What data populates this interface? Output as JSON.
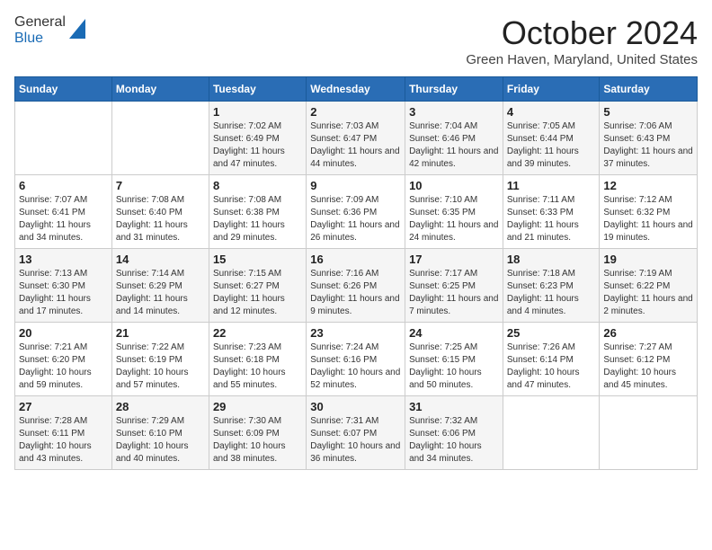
{
  "header": {
    "logo_line1": "General",
    "logo_line2": "Blue",
    "month_title": "October 2024",
    "location": "Green Haven, Maryland, United States"
  },
  "weekdays": [
    "Sunday",
    "Monday",
    "Tuesday",
    "Wednesday",
    "Thursday",
    "Friday",
    "Saturday"
  ],
  "weeks": [
    [
      {
        "day": "",
        "sunrise": "",
        "sunset": "",
        "daylight": ""
      },
      {
        "day": "",
        "sunrise": "",
        "sunset": "",
        "daylight": ""
      },
      {
        "day": "1",
        "sunrise": "Sunrise: 7:02 AM",
        "sunset": "Sunset: 6:49 PM",
        "daylight": "Daylight: 11 hours and 47 minutes."
      },
      {
        "day": "2",
        "sunrise": "Sunrise: 7:03 AM",
        "sunset": "Sunset: 6:47 PM",
        "daylight": "Daylight: 11 hours and 44 minutes."
      },
      {
        "day": "3",
        "sunrise": "Sunrise: 7:04 AM",
        "sunset": "Sunset: 6:46 PM",
        "daylight": "Daylight: 11 hours and 42 minutes."
      },
      {
        "day": "4",
        "sunrise": "Sunrise: 7:05 AM",
        "sunset": "Sunset: 6:44 PM",
        "daylight": "Daylight: 11 hours and 39 minutes."
      },
      {
        "day": "5",
        "sunrise": "Sunrise: 7:06 AM",
        "sunset": "Sunset: 6:43 PM",
        "daylight": "Daylight: 11 hours and 37 minutes."
      }
    ],
    [
      {
        "day": "6",
        "sunrise": "Sunrise: 7:07 AM",
        "sunset": "Sunset: 6:41 PM",
        "daylight": "Daylight: 11 hours and 34 minutes."
      },
      {
        "day": "7",
        "sunrise": "Sunrise: 7:08 AM",
        "sunset": "Sunset: 6:40 PM",
        "daylight": "Daylight: 11 hours and 31 minutes."
      },
      {
        "day": "8",
        "sunrise": "Sunrise: 7:08 AM",
        "sunset": "Sunset: 6:38 PM",
        "daylight": "Daylight: 11 hours and 29 minutes."
      },
      {
        "day": "9",
        "sunrise": "Sunrise: 7:09 AM",
        "sunset": "Sunset: 6:36 PM",
        "daylight": "Daylight: 11 hours and 26 minutes."
      },
      {
        "day": "10",
        "sunrise": "Sunrise: 7:10 AM",
        "sunset": "Sunset: 6:35 PM",
        "daylight": "Daylight: 11 hours and 24 minutes."
      },
      {
        "day": "11",
        "sunrise": "Sunrise: 7:11 AM",
        "sunset": "Sunset: 6:33 PM",
        "daylight": "Daylight: 11 hours and 21 minutes."
      },
      {
        "day": "12",
        "sunrise": "Sunrise: 7:12 AM",
        "sunset": "Sunset: 6:32 PM",
        "daylight": "Daylight: 11 hours and 19 minutes."
      }
    ],
    [
      {
        "day": "13",
        "sunrise": "Sunrise: 7:13 AM",
        "sunset": "Sunset: 6:30 PM",
        "daylight": "Daylight: 11 hours and 17 minutes."
      },
      {
        "day": "14",
        "sunrise": "Sunrise: 7:14 AM",
        "sunset": "Sunset: 6:29 PM",
        "daylight": "Daylight: 11 hours and 14 minutes."
      },
      {
        "day": "15",
        "sunrise": "Sunrise: 7:15 AM",
        "sunset": "Sunset: 6:27 PM",
        "daylight": "Daylight: 11 hours and 12 minutes."
      },
      {
        "day": "16",
        "sunrise": "Sunrise: 7:16 AM",
        "sunset": "Sunset: 6:26 PM",
        "daylight": "Daylight: 11 hours and 9 minutes."
      },
      {
        "day": "17",
        "sunrise": "Sunrise: 7:17 AM",
        "sunset": "Sunset: 6:25 PM",
        "daylight": "Daylight: 11 hours and 7 minutes."
      },
      {
        "day": "18",
        "sunrise": "Sunrise: 7:18 AM",
        "sunset": "Sunset: 6:23 PM",
        "daylight": "Daylight: 11 hours and 4 minutes."
      },
      {
        "day": "19",
        "sunrise": "Sunrise: 7:19 AM",
        "sunset": "Sunset: 6:22 PM",
        "daylight": "Daylight: 11 hours and 2 minutes."
      }
    ],
    [
      {
        "day": "20",
        "sunrise": "Sunrise: 7:21 AM",
        "sunset": "Sunset: 6:20 PM",
        "daylight": "Daylight: 10 hours and 59 minutes."
      },
      {
        "day": "21",
        "sunrise": "Sunrise: 7:22 AM",
        "sunset": "Sunset: 6:19 PM",
        "daylight": "Daylight: 10 hours and 57 minutes."
      },
      {
        "day": "22",
        "sunrise": "Sunrise: 7:23 AM",
        "sunset": "Sunset: 6:18 PM",
        "daylight": "Daylight: 10 hours and 55 minutes."
      },
      {
        "day": "23",
        "sunrise": "Sunrise: 7:24 AM",
        "sunset": "Sunset: 6:16 PM",
        "daylight": "Daylight: 10 hours and 52 minutes."
      },
      {
        "day": "24",
        "sunrise": "Sunrise: 7:25 AM",
        "sunset": "Sunset: 6:15 PM",
        "daylight": "Daylight: 10 hours and 50 minutes."
      },
      {
        "day": "25",
        "sunrise": "Sunrise: 7:26 AM",
        "sunset": "Sunset: 6:14 PM",
        "daylight": "Daylight: 10 hours and 47 minutes."
      },
      {
        "day": "26",
        "sunrise": "Sunrise: 7:27 AM",
        "sunset": "Sunset: 6:12 PM",
        "daylight": "Daylight: 10 hours and 45 minutes."
      }
    ],
    [
      {
        "day": "27",
        "sunrise": "Sunrise: 7:28 AM",
        "sunset": "Sunset: 6:11 PM",
        "daylight": "Daylight: 10 hours and 43 minutes."
      },
      {
        "day": "28",
        "sunrise": "Sunrise: 7:29 AM",
        "sunset": "Sunset: 6:10 PM",
        "daylight": "Daylight: 10 hours and 40 minutes."
      },
      {
        "day": "29",
        "sunrise": "Sunrise: 7:30 AM",
        "sunset": "Sunset: 6:09 PM",
        "daylight": "Daylight: 10 hours and 38 minutes."
      },
      {
        "day": "30",
        "sunrise": "Sunrise: 7:31 AM",
        "sunset": "Sunset: 6:07 PM",
        "daylight": "Daylight: 10 hours and 36 minutes."
      },
      {
        "day": "31",
        "sunrise": "Sunrise: 7:32 AM",
        "sunset": "Sunset: 6:06 PM",
        "daylight": "Daylight: 10 hours and 34 minutes."
      },
      {
        "day": "",
        "sunrise": "",
        "sunset": "",
        "daylight": ""
      },
      {
        "day": "",
        "sunrise": "",
        "sunset": "",
        "daylight": ""
      }
    ]
  ]
}
